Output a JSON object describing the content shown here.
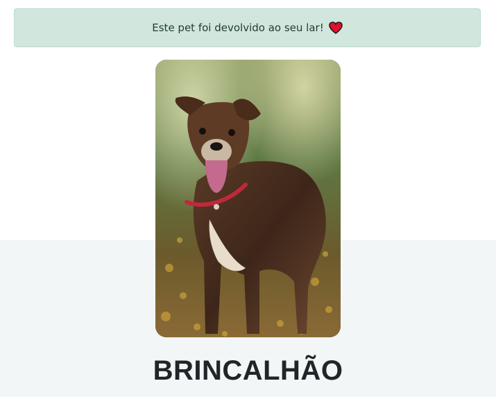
{
  "alert": {
    "message": "Este pet foi devolvido ao seu lar!",
    "icon": "heart-icon",
    "background_color": "#d1e7dd",
    "text_color": "#0f5132"
  },
  "pet": {
    "name": "BRINCALHÃO",
    "photo_icon": "dog-photo"
  },
  "colors": {
    "lower_band": "#f3f6f7",
    "name_text": "#212529"
  }
}
